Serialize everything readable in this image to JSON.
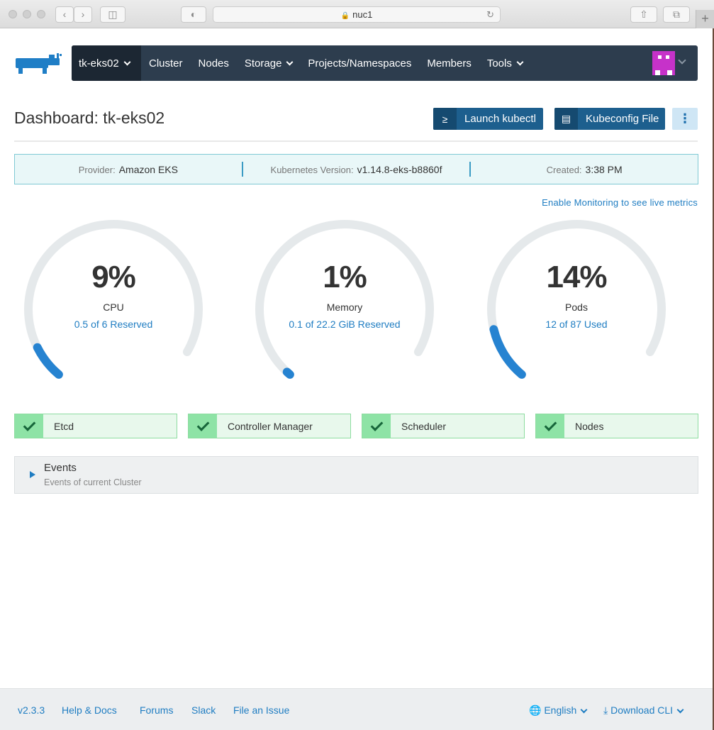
{
  "browser": {
    "url": "nuc1",
    "back_icon": "chevron-left-icon",
    "forward_icon": "chevron-right-icon"
  },
  "header": {
    "cluster_name": "tk-eks02",
    "nav": [
      {
        "label": "Cluster",
        "dropdown": false
      },
      {
        "label": "Nodes",
        "dropdown": false
      },
      {
        "label": "Storage",
        "dropdown": true
      },
      {
        "label": "Projects/Namespaces",
        "dropdown": false
      },
      {
        "label": "Members",
        "dropdown": false
      },
      {
        "label": "Tools",
        "dropdown": true
      }
    ],
    "nav_bg": "#2d3d4e",
    "avatar_color": "#c632c9"
  },
  "page": {
    "title": "Dashboard: tk-eks02",
    "launch_kubectl": "Launch kubectl",
    "kubeconfig_file": "Kubeconfig File"
  },
  "info": {
    "provider_label": "Provider:",
    "provider_value": "Amazon EKS",
    "k8s_label": "Kubernetes Version:",
    "k8s_value": "v1.14.8-eks-b8860f",
    "created_label": "Created:",
    "created_value": "3:38 PM"
  },
  "monitoring_link": "Enable Monitoring to see live metrics",
  "gauges": [
    {
      "value": "9%",
      "fraction": 0.09,
      "label": "CPU",
      "sub": "0.5 of 6 Reserved"
    },
    {
      "value": "1%",
      "fraction": 0.01,
      "label": "Memory",
      "sub": "0.1 of 22.2 GiB Reserved"
    },
    {
      "value": "14%",
      "fraction": 0.14,
      "label": "Pods",
      "sub": "12 of 87 Used"
    }
  ],
  "components": [
    {
      "label": "Etcd",
      "status": "healthy"
    },
    {
      "label": "Controller Manager",
      "status": "healthy"
    },
    {
      "label": "Scheduler",
      "status": "healthy"
    },
    {
      "label": "Nodes",
      "status": "healthy"
    }
  ],
  "events": {
    "title": "Events",
    "subtitle": "Events of current Cluster"
  },
  "footer": {
    "version": "v2.3.3",
    "help": "Help & Docs",
    "forums": "Forums",
    "slack": "Slack",
    "issue": "File an Issue",
    "language": "English",
    "download": "Download CLI"
  },
  "colors": {
    "accent": "#1f7dc2",
    "gauge_track": "#e5e9eb",
    "gauge_fill": "#2683d1",
    "success_bg": "#e8f8ec",
    "success_chk": "#8ee3a6"
  }
}
